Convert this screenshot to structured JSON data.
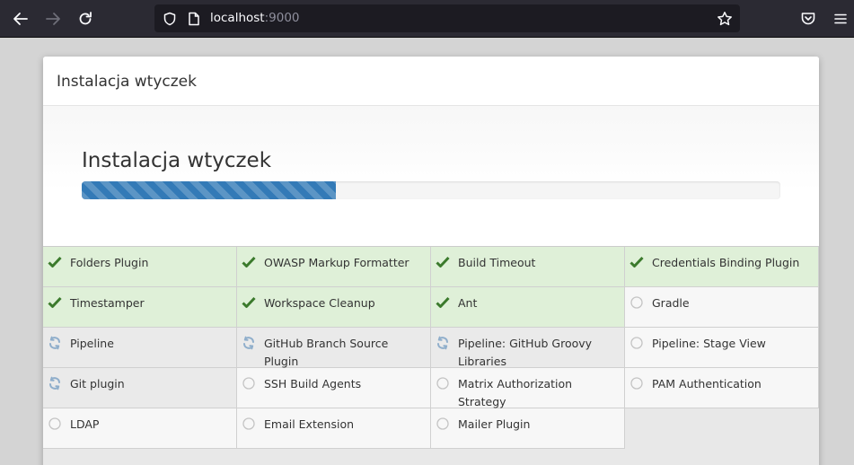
{
  "browser": {
    "url_host": "localhost",
    "url_port": ":9000",
    "icons": {
      "back": "back-arrow-icon",
      "forward": "forward-arrow-icon",
      "reload": "reload-icon",
      "shield": "tracking-shield-icon",
      "page": "page-info-icon",
      "bookmark": "bookmark-star-icon",
      "pocket": "pocket-icon",
      "menu": "hamburger-menu-icon"
    }
  },
  "dialog": {
    "title": "Instalacja wtyczek",
    "install_heading": "Instalacja wtyczek",
    "progress_fraction": 0.364
  },
  "colors": {
    "success_bg": "#dff0d8",
    "check": "#3b7a2c",
    "progress": "#337ab7"
  },
  "plugins": [
    {
      "name": "Folders Plugin",
      "status": "success"
    },
    {
      "name": "OWASP Markup Formatter",
      "status": "success"
    },
    {
      "name": "Build Timeout",
      "status": "success"
    },
    {
      "name": "Credentials Binding Plugin",
      "status": "success"
    },
    {
      "name": "Timestamper",
      "status": "success"
    },
    {
      "name": "Workspace Cleanup",
      "status": "success"
    },
    {
      "name": "Ant",
      "status": "success"
    },
    {
      "name": "Gradle",
      "status": "pending"
    },
    {
      "name": "Pipeline",
      "status": "installing"
    },
    {
      "name": "GitHub Branch Source Plugin",
      "status": "installing"
    },
    {
      "name": "Pipeline: GitHub Groovy Libraries",
      "status": "installing"
    },
    {
      "name": "Pipeline: Stage View",
      "status": "pending"
    },
    {
      "name": "Git plugin",
      "status": "installing"
    },
    {
      "name": "SSH Build Agents",
      "status": "pending"
    },
    {
      "name": "Matrix Authorization Strategy",
      "status": "pending"
    },
    {
      "name": "PAM Authentication",
      "status": "pending"
    },
    {
      "name": "LDAP",
      "status": "pending"
    },
    {
      "name": "Email Extension",
      "status": "pending"
    },
    {
      "name": "Mailer Plugin",
      "status": "pending"
    }
  ]
}
